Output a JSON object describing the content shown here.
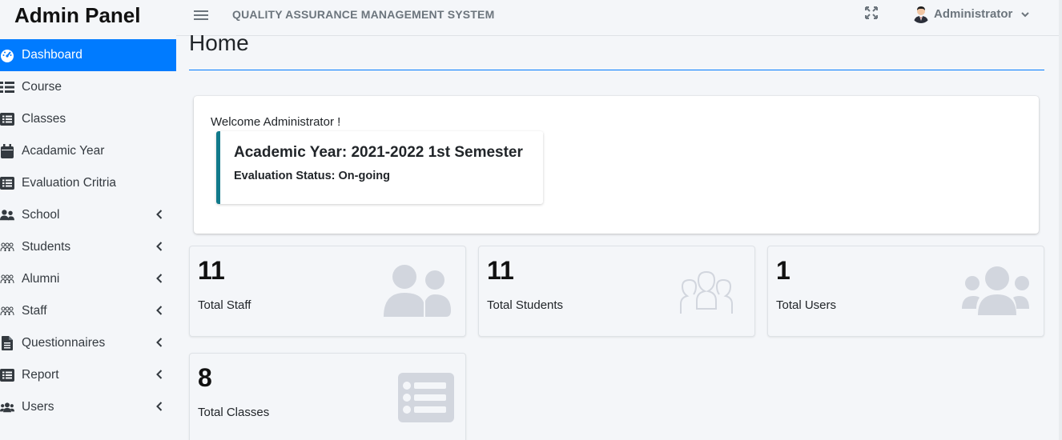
{
  "brand": {
    "title": "Admin Panel"
  },
  "sidebar": {
    "items": [
      {
        "label": "Dashboard",
        "icon": "tachometer-icon",
        "active": true,
        "has_submenu": false
      },
      {
        "label": "Course",
        "icon": "list-icon",
        "has_submenu": false
      },
      {
        "label": "Classes",
        "icon": "list-alt-icon",
        "has_submenu": false
      },
      {
        "label": "Acadamic Year",
        "icon": "calendar-icon",
        "has_submenu": false
      },
      {
        "label": "Evaluation Critria",
        "icon": "list-alt-icon",
        "has_submenu": false
      },
      {
        "label": "School",
        "icon": "user-friends-icon",
        "has_submenu": true
      },
      {
        "label": "Students",
        "icon": "people-outline-icon",
        "has_submenu": true
      },
      {
        "label": "Alumni",
        "icon": "people-outline-icon",
        "has_submenu": true
      },
      {
        "label": "Staff",
        "icon": "people-outline-icon",
        "has_submenu": true
      },
      {
        "label": "Questionnaires",
        "icon": "file-alt-icon",
        "has_submenu": true
      },
      {
        "label": "Report",
        "icon": "list-alt-icon",
        "has_submenu": true
      },
      {
        "label": "Users",
        "icon": "users-icon",
        "has_submenu": true
      }
    ]
  },
  "topbar": {
    "system_title": "QUALITY ASSURANCE MANAGEMENT SYSTEM",
    "user_name": "Administrator"
  },
  "main": {
    "page_title": "Home",
    "welcome": {
      "text": "Welcome Administrator !",
      "academic_year": "Academic Year: 2021-2022 1st Semester",
      "evaluation_status": "Evaluation Status: On-going"
    },
    "stats": [
      {
        "value": "11",
        "label": "Total Staff",
        "icon": "user-friends-icon"
      },
      {
        "value": "11",
        "label": "Total Students",
        "icon": "people-outline-icon"
      },
      {
        "value": "1",
        "label": "Total Users",
        "icon": "users-icon"
      },
      {
        "value": "8",
        "label": "Total Classes",
        "icon": "list-alt-icon"
      }
    ]
  },
  "colors": {
    "accent": "#007bff",
    "callout_border": "#117a8b",
    "icon_gray": "#d2d6de"
  }
}
